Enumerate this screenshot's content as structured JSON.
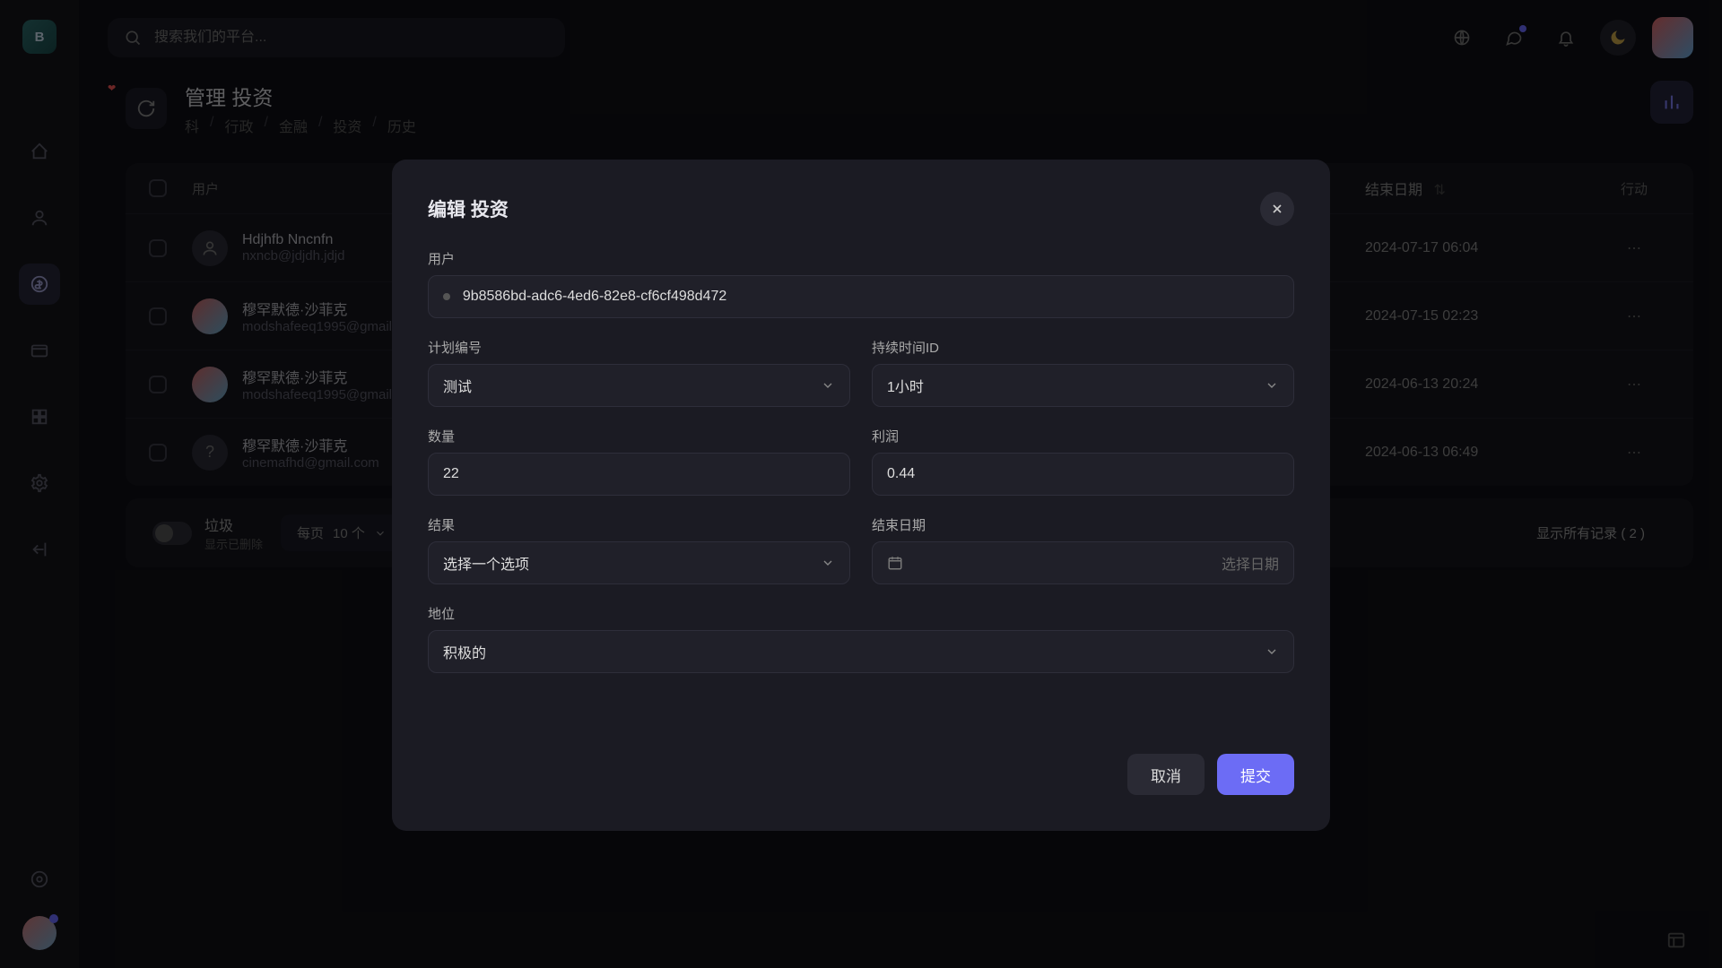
{
  "search": {
    "placeholder": "搜索我们的平台..."
  },
  "page": {
    "title": "管理 投资",
    "crumbs": [
      "科",
      "行政",
      "金融",
      "投资",
      "历史"
    ]
  },
  "tableHead": {
    "user": "用户",
    "endDate": "结束日期",
    "action": "行动"
  },
  "rows": [
    {
      "name": "Hdjhfb Nncnfn",
      "email": "nxncb@jdjdh.jdjd",
      "date": "2024-07-17 06:04",
      "avatar": "blank"
    },
    {
      "name": "穆罕默德·沙菲克",
      "email": "modshafeeq1995@gmail",
      "date": "2024-07-15 02:23",
      "avatar": "img"
    },
    {
      "name": "穆罕默德·沙菲克",
      "email": "modshafeeq1995@gmail",
      "date": "2024-06-13 20:24",
      "avatar": "img"
    },
    {
      "name": "穆罕默德·沙菲克",
      "email": "cinemafhd@gmail.com",
      "date": "2024-06-13 06:49",
      "avatar": "q"
    }
  ],
  "footer": {
    "trashTitle": "垃圾",
    "trashSub": "显示已删除",
    "perPage": "每页",
    "perPageVal": "10 个",
    "records": "显示所有记录 ( 2 )"
  },
  "modal": {
    "title": "编辑 投资",
    "labels": {
      "user": "用户",
      "plan": "计划编号",
      "duration": "持续时间ID",
      "amount": "数量",
      "profit": "利润",
      "result": "结果",
      "endDate": "结束日期",
      "status": "地位"
    },
    "values": {
      "user": "9b8586bd-adc6-4ed6-82e8-cf6cf498d472",
      "plan": "测试",
      "duration": "1小时",
      "amount": "22",
      "profit": "0.44",
      "result": "选择一个选项",
      "datePlaceholder": "选择日期",
      "status": "积极的"
    },
    "buttons": {
      "cancel": "取消",
      "submit": "提交"
    }
  }
}
